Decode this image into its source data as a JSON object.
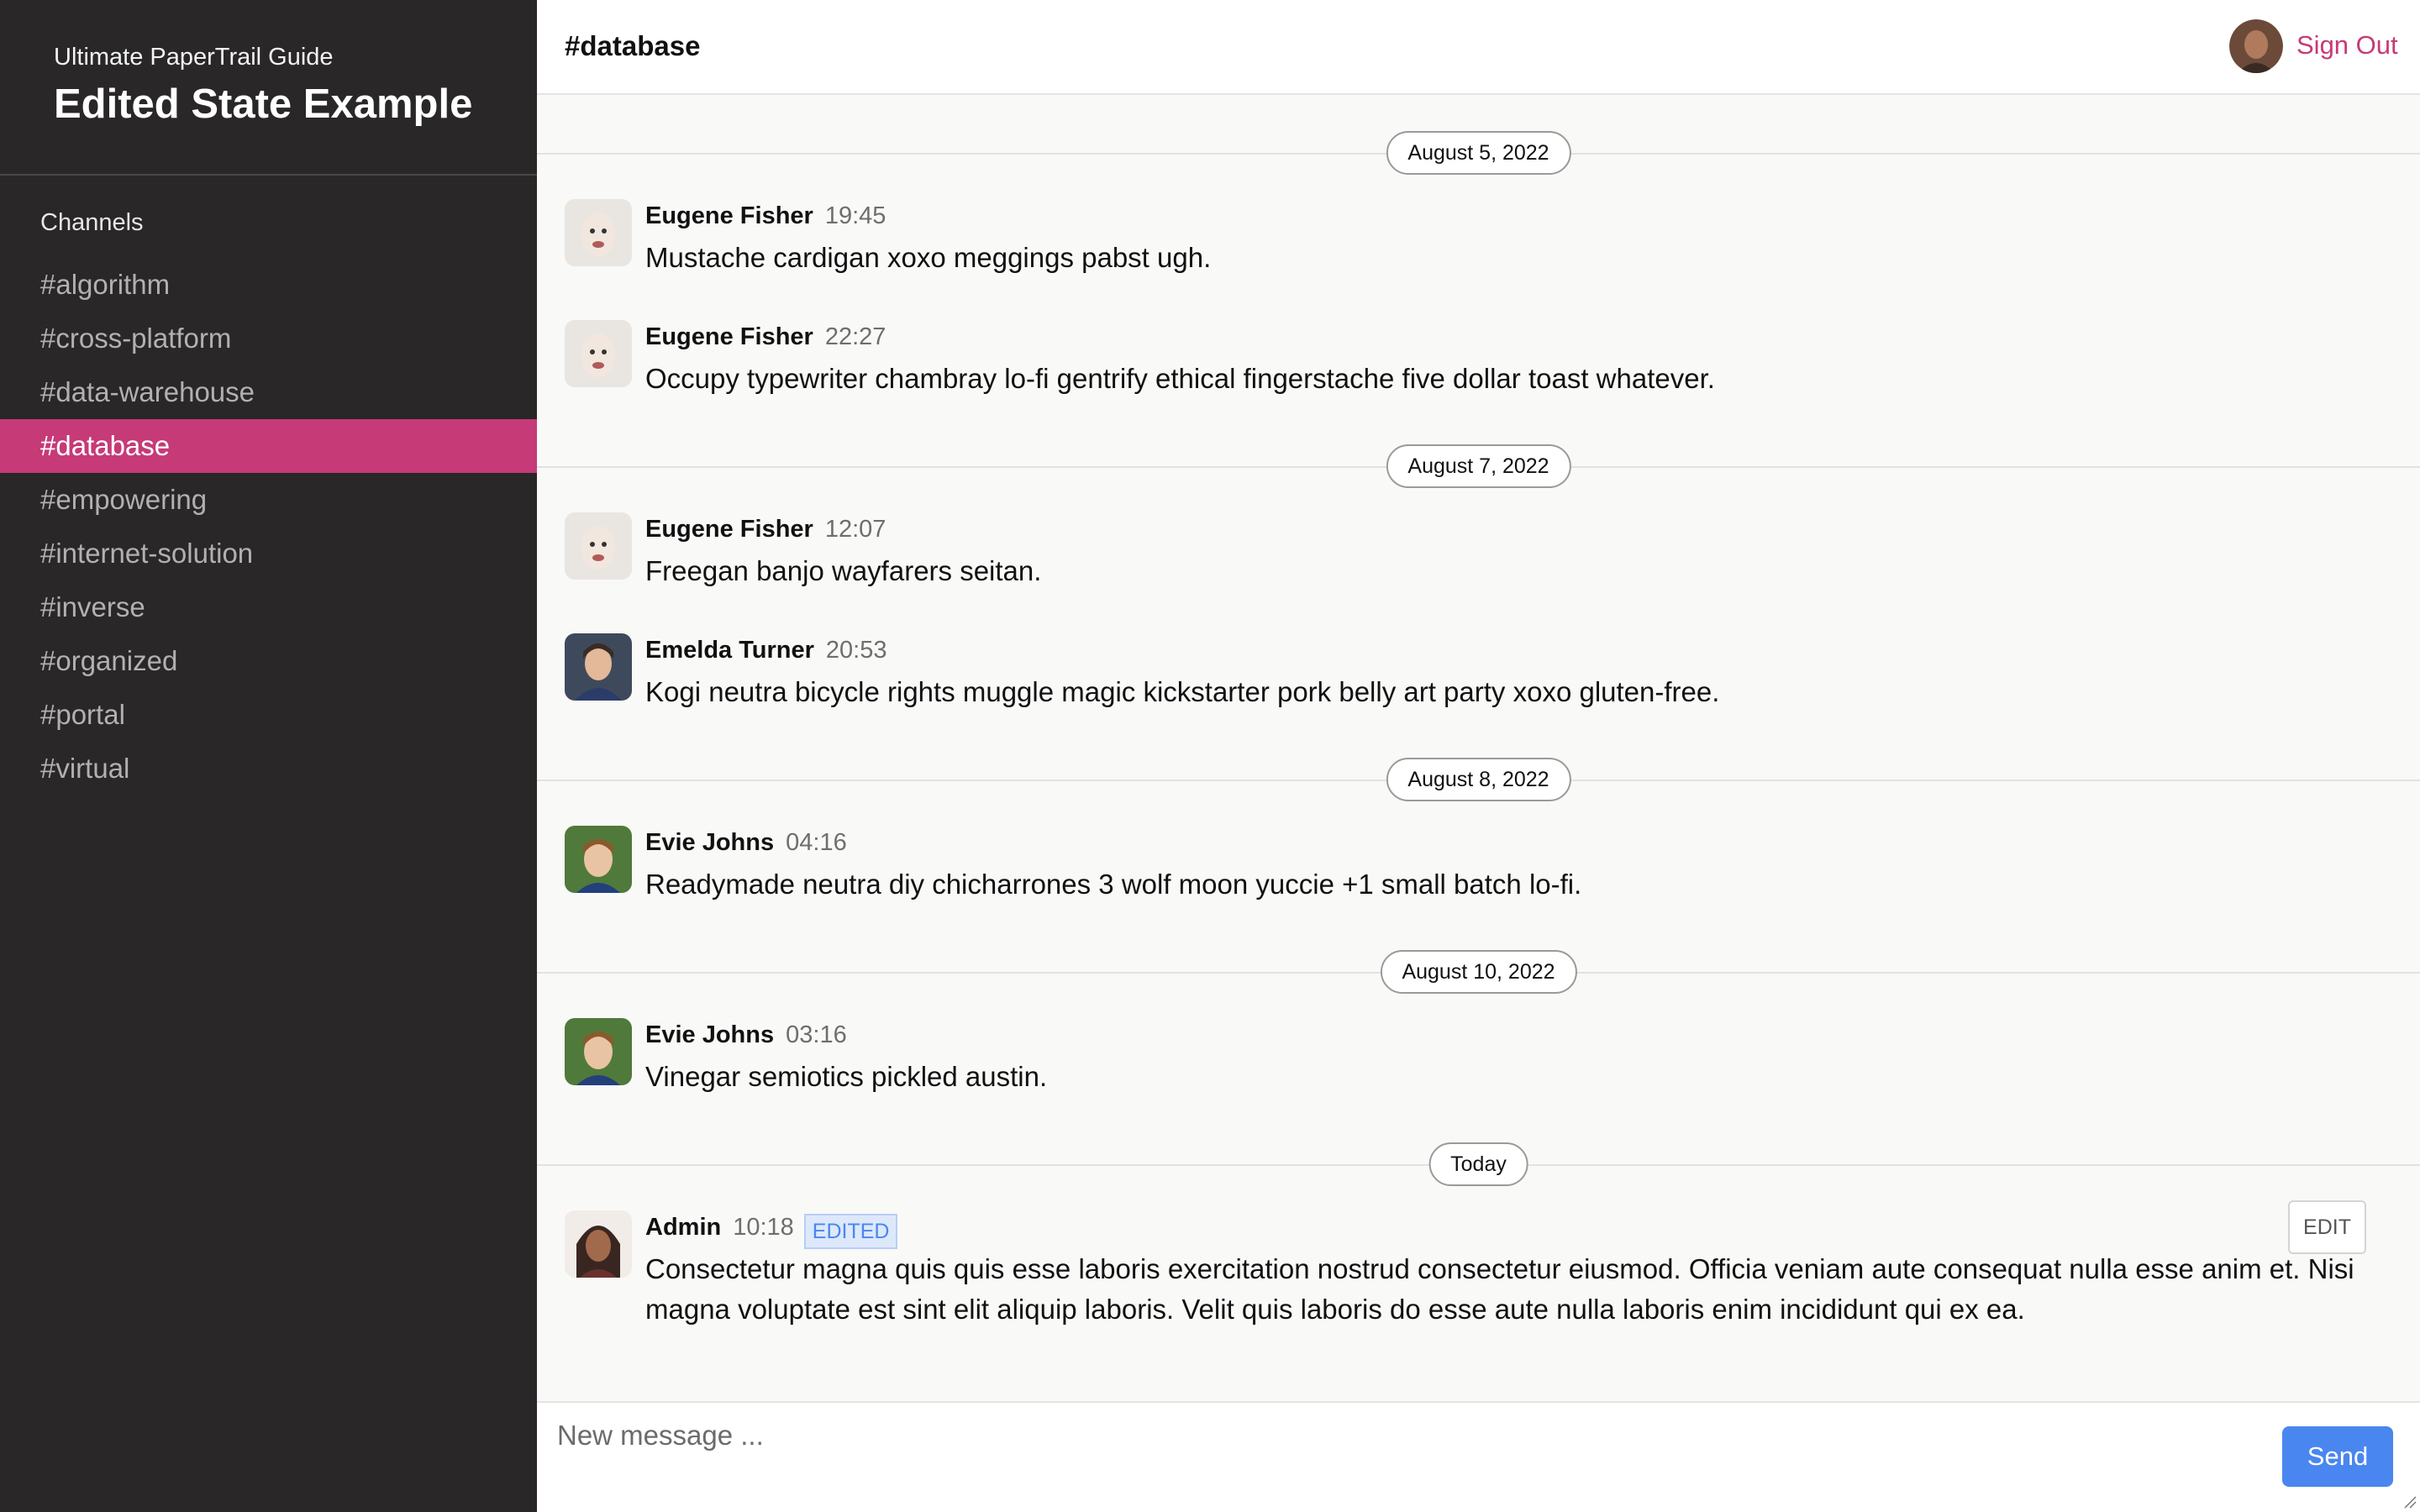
{
  "sidebar": {
    "subtitle": "Ultimate PaperTrail Guide",
    "title": "Edited State Example",
    "channels_heading": "Channels",
    "channels": [
      {
        "label": "#algorithm"
      },
      {
        "label": "#cross-platform"
      },
      {
        "label": "#data-warehouse"
      },
      {
        "label": "#database",
        "active": true
      },
      {
        "label": "#empowering"
      },
      {
        "label": "#internet-solution"
      },
      {
        "label": "#inverse"
      },
      {
        "label": "#organized"
      },
      {
        "label": "#portal"
      },
      {
        "label": "#virtual"
      }
    ]
  },
  "header": {
    "channel": "#database",
    "sign_out": "Sign Out",
    "user_avatar_icon": "user-avatar-icon"
  },
  "dates": [
    "August 5, 2022",
    "August 7, 2022",
    "August 8, 2022",
    "August 10, 2022",
    "Today"
  ],
  "messages": [
    {
      "author": "Eugene Fisher",
      "time": "19:45",
      "text": "Mustache cardigan xoxo meggings pabst ugh."
    },
    {
      "author": "Eugene Fisher",
      "time": "22:27",
      "text": "Occupy typewriter chambray lo-fi gentrify ethical fingerstache five dollar toast whatever."
    },
    {
      "author": "Eugene Fisher",
      "time": "12:07",
      "text": "Freegan banjo wayfarers seitan."
    },
    {
      "author": "Emelda Turner",
      "time": "20:53",
      "text": "Kogi neutra bicycle rights muggle magic kickstarter pork belly art party xoxo gluten-free."
    },
    {
      "author": "Evie Johns",
      "time": "04:16",
      "text": "Readymade neutra diy chicharrones 3 wolf moon yuccie +1 small batch lo-fi."
    },
    {
      "author": "Evie Johns",
      "time": "03:16",
      "text": "Vinegar semiotics pickled austin."
    },
    {
      "author": "Admin",
      "time": "10:18",
      "badge": "EDITED",
      "edit_label": "EDIT",
      "text": "Consectetur magna quis quis esse laboris exercitation nostrud consectetur eiusmod. Officia veniam aute consequat nulla esse anim et. Nisi magna voluptate est sint elit aliquip laboris. Velit quis laboris do esse aute nulla laboris enim incididunt qui ex ea."
    }
  ],
  "composer": {
    "placeholder": "New message ...",
    "send_label": "Send"
  },
  "colors": {
    "sidebar_bg": "#292727",
    "accent": "#c63a77",
    "send_button": "#4a86f0"
  }
}
